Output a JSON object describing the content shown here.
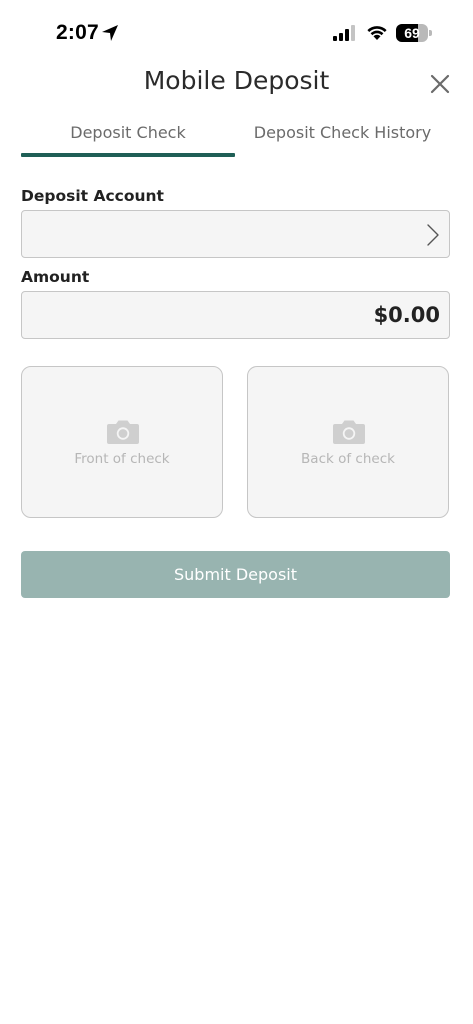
{
  "status_bar": {
    "time": "2:07",
    "battery_level": 69,
    "battery_text": "69"
  },
  "header": {
    "title": "Mobile Deposit"
  },
  "tabs": [
    {
      "label": "Deposit Check",
      "active": true
    },
    {
      "label": "Deposit Check History",
      "active": false
    }
  ],
  "form": {
    "deposit_account_label": "Deposit Account",
    "deposit_account_value": "",
    "amount_label": "Amount",
    "amount_value": "$0.00"
  },
  "check_images": {
    "front_label": "Front of check",
    "back_label": "Back of check"
  },
  "submit": {
    "label": "Submit Deposit"
  },
  "colors": {
    "accent": "#1f5f56",
    "submit_disabled": "#98b4b0",
    "field_bg": "#f5f5f5",
    "field_border": "#c6c6c6"
  }
}
